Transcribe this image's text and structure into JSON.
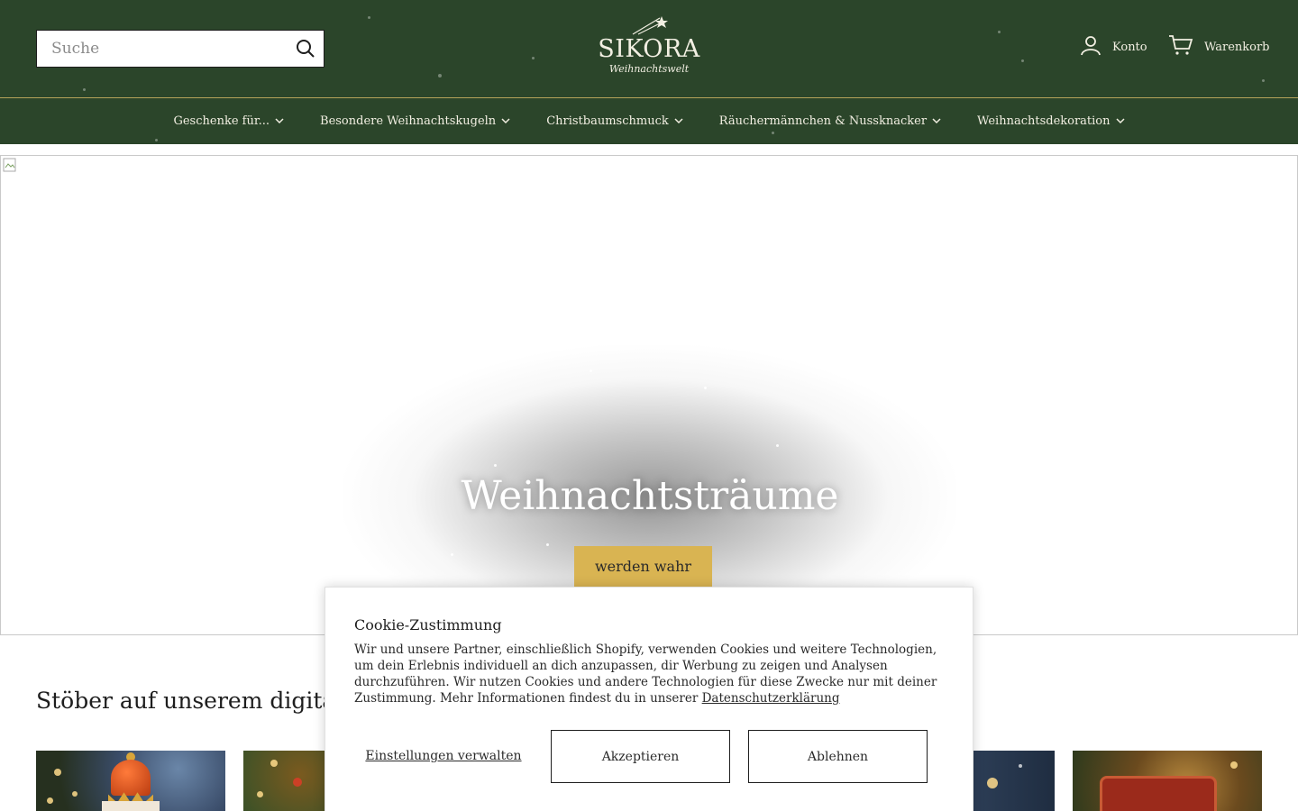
{
  "header": {
    "search_placeholder": "Suche",
    "logo_brand": "SIKORA",
    "logo_sub": "Weihnachtswelt",
    "account_label": "Konto",
    "cart_label": "Warenkorb"
  },
  "nav": {
    "items": [
      {
        "label": "Geschenke für..."
      },
      {
        "label": "Besondere Weihnachtskugeln"
      },
      {
        "label": "Christbaumschmuck"
      },
      {
        "label": "Räuchermännchen & Nussknacker"
      },
      {
        "label": "Weihnachtsdekoration"
      }
    ]
  },
  "hero": {
    "title": "Weihnachtsträume",
    "button_label": "werden wahr"
  },
  "section": {
    "title": "Stöber auf unserem digitalen W"
  },
  "cookie": {
    "title": "Cookie-Zustimmung",
    "text": "Wir und unsere Partner, einschließlich Shopify, verwenden Cookies und weitere Technologien, um dein Erlebnis individuell an dich anzupassen, dir Werbung zu zeigen und Analysen durchzuführen. Wir nutzen Cookies und andere Technologien für diese Zwecke nur mit deiner Zustimmung. Mehr Informationen findest du in unserer ",
    "privacy_link": "Datenschutzerklärung",
    "manage_label": "Einstellungen verwalten",
    "accept_label": "Akzeptieren",
    "decline_label": "Ablehnen"
  },
  "colors": {
    "header_bg": "#2b452a",
    "accent_gold": "#d9b452",
    "nav_divider": "#b4a25a"
  },
  "icons": {
    "search": "search-icon",
    "account": "user-icon",
    "cart": "cart-icon",
    "chevron": "chevron-down-icon",
    "broken_image": "broken-image-icon"
  }
}
